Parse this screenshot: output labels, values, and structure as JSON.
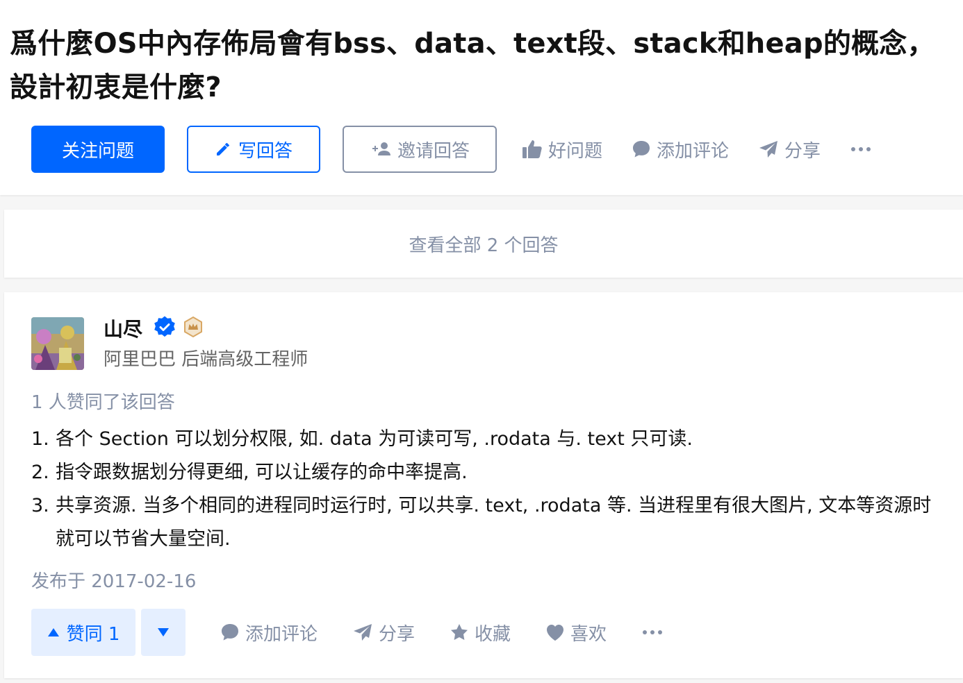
{
  "question": {
    "title": "爲什麼OS中內存佈局會有bss、data、text段、stack和heap的概念，設計初衷是什麼?"
  },
  "question_actions": {
    "follow_label": "关注问题",
    "write_label": "写回答",
    "invite_label": "邀请回答",
    "good_label": "好问题",
    "comment_label": "添加评论",
    "share_label": "分享"
  },
  "view_all": {
    "label": "查看全部 2 个回答"
  },
  "answer": {
    "author": {
      "name": "山尽",
      "headline": "阿里巴巴 后端高级工程师",
      "avatar_icon": "avatar-image",
      "verified_icon": "verified-badge-icon",
      "crown_icon": "crown-badge-icon"
    },
    "vote_summary": "1 人赞同了该回答",
    "content": [
      {
        "num": "1.",
        "text": "各个 Section 可以划分权限, 如. data 为可读可写, .rodata 与. text 只可读."
      },
      {
        "num": "2.",
        "text": "指令跟数据划分得更细, 可以让缓存的命中率提高."
      },
      {
        "num": "3.",
        "text": "共享资源. 当多个相同的进程同时运行时, 可以共享. text, .rodata 等. 当进程里有很大图片, 文本等资源时就可以节省大量空间."
      }
    ],
    "published": "发布于 2017-02-16",
    "actions": {
      "upvote_label": "赞同 1",
      "comment_label": "添加评论",
      "share_label": "分享",
      "collect_label": "收藏",
      "like_label": "喜欢"
    }
  },
  "colors": {
    "primary": "#0066ff",
    "muted": "#8590a6",
    "vote_bg": "#e5efff",
    "text": "#121212"
  }
}
